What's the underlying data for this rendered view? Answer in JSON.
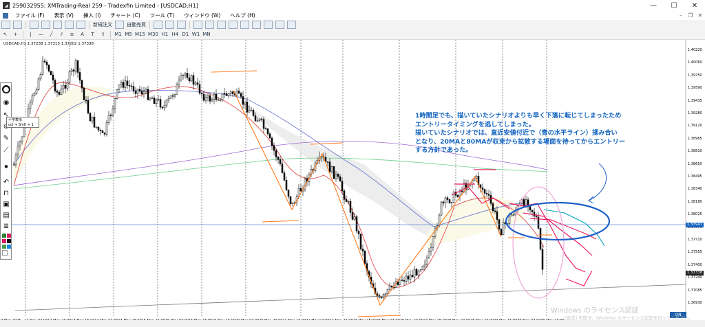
{
  "window": {
    "title": "259032955: XMTrading-Real 259 - Tradexfin Limited - [USDCAD,H1]",
    "min": "—",
    "max": "☐",
    "close": "✕"
  },
  "menu": [
    "ファイル (F)",
    "表示 (V)",
    "挿入 (I)",
    "チャート (C)",
    "ツール (T)",
    "ウィンドウ (W)",
    "ヘルプ (H)"
  ],
  "toolbar": {
    "new_order": "新規注文",
    "auto_trade": "自動売買",
    "timeframes": [
      "M1",
      "M5",
      "M15",
      "M30",
      "H1",
      "H4",
      "D1",
      "W1",
      "MN"
    ]
  },
  "chart": {
    "symbol_label": "USDCAD,H1 1.37238 1.37315 1.37202 1.37338",
    "price_tags": {
      "bid": "1.37947",
      "last": "1.37338"
    },
    "price_axis": [
      "1.40220",
      "1.40060",
      "1.39750",
      "1.39590",
      "1.39435",
      "1.39280",
      "1.39120",
      "1.38965",
      "1.38810",
      "1.38650",
      "1.38495",
      "1.38340",
      "1.38180",
      "1.38025",
      "1.37870",
      "1.37710",
      "1.37555",
      "1.37400",
      "1.37240",
      "1.37085",
      "1.36930"
    ],
    "time_axis": [
      "9 May 2025",
      "12 May 07:00",
      "12 May 23:00",
      "13 May 15:00",
      "14 May 07:00",
      "14 May 23:00",
      "15 May 15:00",
      "16 May 07:00",
      "16 May 23:00",
      "19 May 15:00",
      "20 May 07:00",
      "20 May 23:00",
      "21 May 15:00",
      "22 May 07:00",
      "22 May 23:00",
      "23 May 15:00",
      "26 May 07:00",
      "26 May 23:00",
      "27 May 15:00",
      "28 May 07:00",
      "28 May 23:00",
      "29 May 15:00",
      "30 May 07:00",
      "30 May 23:00"
    ],
    "on_label": "ON",
    "watermark_line1": "Windows のライセンス認証",
    "watermark_line2": "[設定] を開き、Windows のライセンス認証を行ってください。",
    "tooltip_line1": "十字表示",
    "tooltip_line2": "ool + Shift + 1"
  },
  "annotation": [
    "1時間足でも、描いていたシナリオよりも早く下落に転じてしまったため",
    "エントリータイミングを逃してしまった。",
    "描いていたシナリオでは、直近安値付近で（青の水平ライン）揉み合い",
    "となり、20MAと80MAが収束から拡散する場面を待ってからエントリー",
    "する方針であった。"
  ],
  "colors": {
    "annotation_text": "#1565c0",
    "ma_fast": "#e53935",
    "ma_slow": "#5c6bc0",
    "ma_long": "#7b1fa2",
    "ma_green": "#66bb6a",
    "trend_lines": "#ff6d00",
    "horizontal_level": "#1565c0",
    "scenario": "#e91e63",
    "highlight_circle": "#f48fb1",
    "blue_ellipse": "#1e5fc8"
  }
}
